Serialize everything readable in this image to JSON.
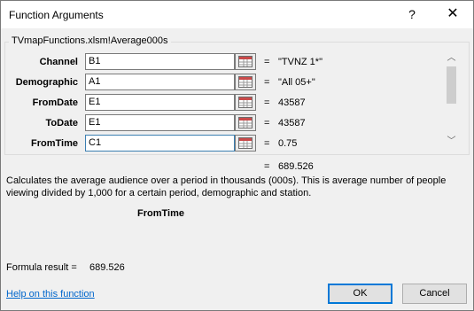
{
  "dialog": {
    "title": "Function Arguments",
    "help_glyph": "?",
    "close_glyph": "✕"
  },
  "group": {
    "title": "TVmapFunctions.xlsm!Average000s"
  },
  "arguments": [
    {
      "label": "Channel",
      "input": "B1",
      "value": "\"TVNZ 1*\""
    },
    {
      "label": "Demographic",
      "input": "A1",
      "value": "\"All 05+\""
    },
    {
      "label": "FromDate",
      "input": "E1",
      "value": "43587"
    },
    {
      "label": "ToDate",
      "input": "E1",
      "value": "43587"
    },
    {
      "label": "FromTime",
      "input": "C1",
      "value": "0.75"
    }
  ],
  "eq_sign": "=",
  "result": {
    "value": "689.526"
  },
  "description": "Calculates the average audience over a period in thousands (000s). This is average number of people viewing divided by 1,000 for a certain period, demographic and station.",
  "current_argument": "FromTime",
  "formula_result": {
    "label": "Formula result =",
    "value": "689.526"
  },
  "help_link": "Help on this function",
  "buttons": {
    "ok": "OK",
    "cancel": "Cancel"
  },
  "scroll": {
    "up_glyph": "︿",
    "down_glyph": "﹀"
  }
}
